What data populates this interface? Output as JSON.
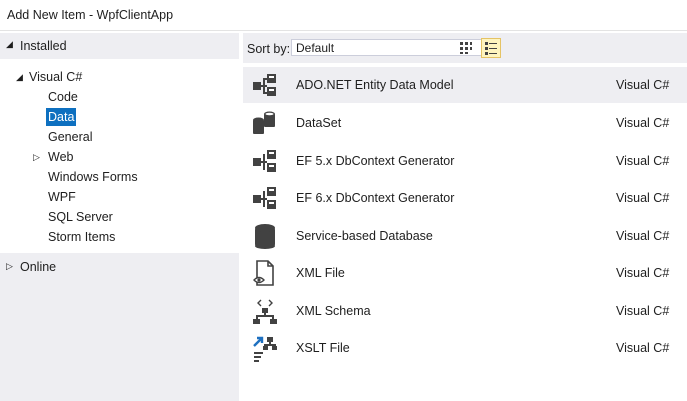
{
  "window": {
    "title": "Add New Item - WpfClientApp"
  },
  "left": {
    "installed_label": "Installed",
    "tree": [
      {
        "label": "Visual C#",
        "expander": "◢"
      },
      {
        "label": "Code"
      },
      {
        "label": "Data",
        "selected": true
      },
      {
        "label": "General"
      },
      {
        "label": "Web",
        "expander": "▷"
      },
      {
        "label": "Windows Forms"
      },
      {
        "label": "WPF"
      },
      {
        "label": "SQL Server"
      },
      {
        "label": "Storm Items"
      }
    ],
    "online_label": "Online"
  },
  "right": {
    "sort_label": "Sort by:",
    "sort_value": "Default",
    "items": [
      {
        "name": "ADO.NET Entity Data Model",
        "lang": "Visual C#",
        "icon": "entity-model-icon"
      },
      {
        "name": "DataSet",
        "lang": "Visual C#",
        "icon": "dataset-icon"
      },
      {
        "name": "EF 5.x DbContext Generator",
        "lang": "Visual C#",
        "icon": "ef-generator-icon"
      },
      {
        "name": "EF 6.x DbContext Generator",
        "lang": "Visual C#",
        "icon": "ef-generator-icon"
      },
      {
        "name": "Service-based Database",
        "lang": "Visual C#",
        "icon": "database-icon"
      },
      {
        "name": "XML File",
        "lang": "Visual C#",
        "icon": "xml-file-icon"
      },
      {
        "name": "XML Schema",
        "lang": "Visual C#",
        "icon": "xml-schema-icon"
      },
      {
        "name": "XSLT File",
        "lang": "Visual C#",
        "icon": "xslt-file-icon"
      }
    ]
  },
  "colors": {
    "selection": "#0e70c0",
    "pane_header": "#eeeef2",
    "accent_icon": "#1e70c0"
  }
}
